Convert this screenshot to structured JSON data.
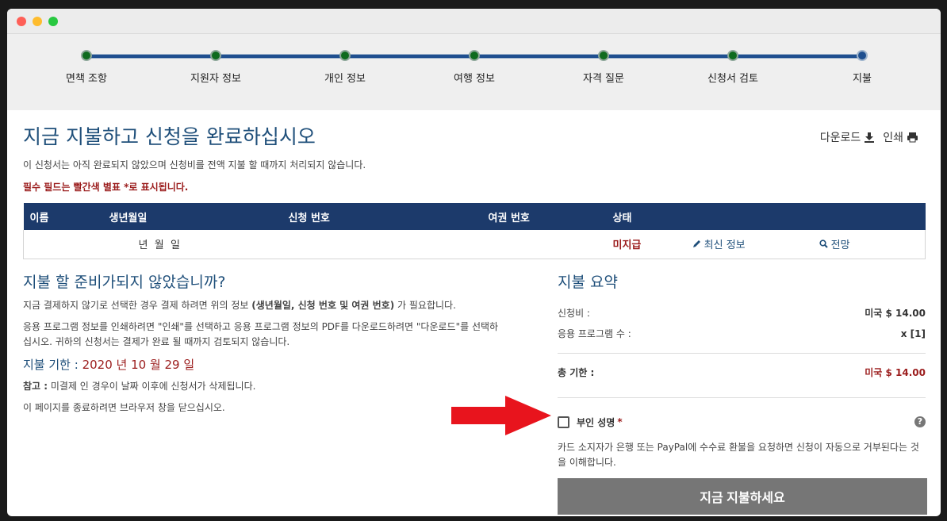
{
  "steps": [
    "면책 조항",
    "지원자 정보",
    "개인 정보",
    "여행 정보",
    "자격 질문",
    "신청서 검토",
    "지불"
  ],
  "actions": {
    "download": "다운로드",
    "print": "인쇄"
  },
  "page": {
    "title": "지금 지불하고 신청을 완료하십시오",
    "subtitle": "이 신청서는 아직 완료되지 않았으며 신청비를 전액 지불 할 때까지 처리되지 않습니다.",
    "required_note": "필수 필드는 빨간색 별표 *로 표시됩니다."
  },
  "table": {
    "headers": [
      "이름",
      "생년월일",
      "신청 번호",
      "여권 번호",
      "상태"
    ],
    "row": {
      "dob": "년  월  일",
      "status": "미지급",
      "update": "최신 정보",
      "view": "전망"
    }
  },
  "left": {
    "heading": "지불 할 준비가되지 않았습니까?",
    "p1a": "지금 결제하지 않기로 선택한 경우 결제 하려면 위의 정보 ",
    "p1b": "(생년월일, 신청 번호 및 여권 번호)",
    "p1c": " 가 필요합니다.",
    "p2": "응용 프로그램 정보를 인쇄하려면 \"인쇄\"를 선택하고 응용 프로그램 정보의 PDF를 다운로드하려면 \"다운로드\"를 선택하십시오. 귀하의 신청서는 결제가 완료 될 때까지 검토되지 않습니다.",
    "due_label": "지불 기한 : ",
    "due_date": "2020 년 10 월 29 일",
    "note_label": "참고 :",
    "note": " 미결제 인 경우이 날짜 이후에 신청서가 삭제됩니다.",
    "close": "이 페이지를 종료하려면 브라우저 창을 닫으십시오."
  },
  "summary": {
    "heading": "지불 요약",
    "fee_label": "신청비 :",
    "fee_value": "미국 $ 14.00",
    "count_label": "응용 프로그램 수 :",
    "count_value": "x [1]",
    "total_label": "총 기한 :",
    "total_value": "미국 $ 14.00",
    "sig_label": "부인 성명",
    "sig_star": "*",
    "sig_help": "?",
    "sig_note": "카드 소지자가 은행 또는 PayPal에 수수료 환불을 요청하면 신청이 자동으로 거부된다는 것을 이해합니다.",
    "pay_button": "지금 지불하세요"
  }
}
